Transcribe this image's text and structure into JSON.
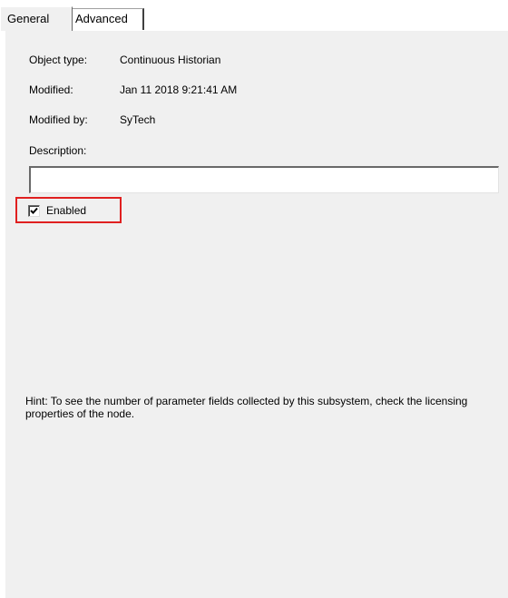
{
  "tabs": [
    {
      "label": "General",
      "active": true
    },
    {
      "label": "Advanced",
      "active": false
    }
  ],
  "fields": {
    "object_type": {
      "label": "Object type:",
      "value": "Continuous Historian"
    },
    "modified": {
      "label": "Modified:",
      "value": "Jan 11 2018 9:21:41 AM"
    },
    "modified_by": {
      "label": "Modified by:",
      "value": "SyTech"
    }
  },
  "description": {
    "label": "Description:",
    "value": ""
  },
  "enabled": {
    "label": "Enabled",
    "checked": true
  },
  "hint": "Hint: To see the number of parameter fields collected by this subsystem, check the licensing properties of the node.",
  "colors": {
    "panel_background": "#f0f0f0",
    "highlight_box": "#e02020"
  },
  "icons": {
    "checkbox_mark": "check-icon"
  }
}
